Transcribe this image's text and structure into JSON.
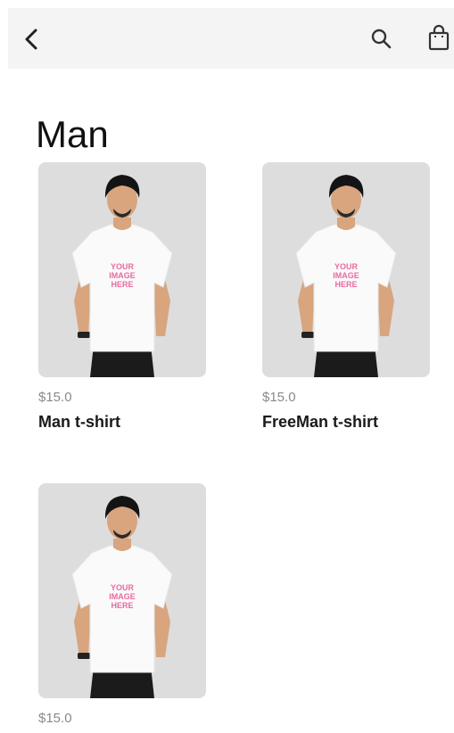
{
  "header": {
    "back_icon": "chevron-left-icon",
    "search_icon": "search-icon",
    "bag_icon": "shopping-bag-icon"
  },
  "page": {
    "title": "Man"
  },
  "products": [
    {
      "price": "$15.0",
      "name": "Man t-shirt"
    },
    {
      "price": "$15.0",
      "name": "FreeMan t-shirt"
    },
    {
      "price": "$15.0",
      "name": ""
    }
  ],
  "shirt_print": [
    "YOUR",
    "IMAGE",
    "HERE"
  ],
  "colors": {
    "topbar": "#f4f4f4",
    "card_bg": "#dddddd",
    "price": "#8a8a8a",
    "title": "#111111",
    "print": "#e86aa0"
  }
}
